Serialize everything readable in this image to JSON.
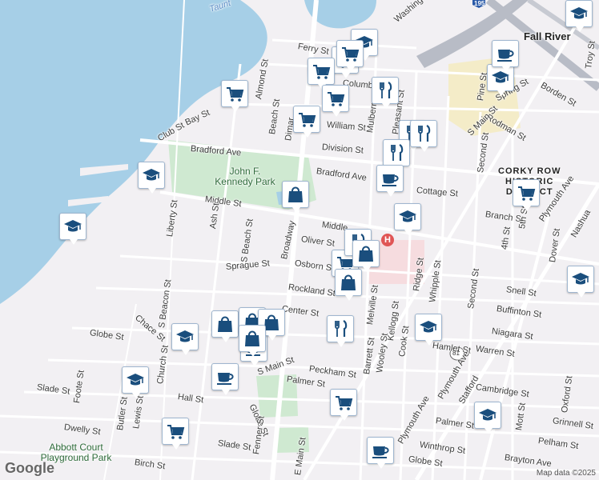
{
  "map": {
    "city": "Fall River",
    "district": [
      "CORKY ROW",
      "HISTORIC",
      "DISTRICT"
    ],
    "attribution": "Map data ©2025",
    "logo": "Google",
    "highway_shield": "195",
    "route_shield": "81",
    "hospital_letter": "H",
    "parks": [
      {
        "id": "jfk",
        "text": "John F. Kennedy Park"
      },
      {
        "id": "abbott",
        "text": "Abbott Court Playground Park"
      }
    ],
    "water_label": "Taunt",
    "streets": [
      {
        "text": "Ferry St"
      },
      {
        "text": "Columbia"
      },
      {
        "text": "Almond St"
      },
      {
        "text": "Club St"
      },
      {
        "text": "Bay St"
      },
      {
        "text": "Bradford Ave"
      },
      {
        "text": "Bradford Ave"
      },
      {
        "text": "Beach St"
      },
      {
        "text": "Dimar"
      },
      {
        "text": "William St"
      },
      {
        "text": "Division St"
      },
      {
        "text": "Cottage St"
      },
      {
        "text": "Middle St"
      },
      {
        "text": "Middle"
      },
      {
        "text": "Oliver St"
      },
      {
        "text": "Sprague St"
      },
      {
        "text": "Osborn St"
      },
      {
        "text": "Rockland St"
      },
      {
        "text": "Center St"
      },
      {
        "text": "Broadway"
      },
      {
        "text": "Liberty St"
      },
      {
        "text": "Ash St"
      },
      {
        "text": "S Beach St"
      },
      {
        "text": "S Beacon St"
      },
      {
        "text": "Chace St"
      },
      {
        "text": "Globe St"
      },
      {
        "text": "Church St"
      },
      {
        "text": "Hall St"
      },
      {
        "text": "Slade St"
      },
      {
        "text": "Foote St"
      },
      {
        "text": "Butler St"
      },
      {
        "text": "Lewis St"
      },
      {
        "text": "Dwelly St"
      },
      {
        "text": "Birch St"
      },
      {
        "text": "S Main St"
      },
      {
        "text": "Globe St"
      },
      {
        "text": "Palmer St"
      },
      {
        "text": "Peckham St"
      },
      {
        "text": "Fenner St"
      },
      {
        "text": "E Main St"
      },
      {
        "text": "Slade St"
      },
      {
        "text": "Globe St"
      },
      {
        "text": "Winthrop St"
      },
      {
        "text": "Palmer St"
      },
      {
        "text": "Plymouth Ave"
      },
      {
        "text": "Plymouth Ave"
      },
      {
        "text": "Brayton Ave"
      },
      {
        "text": "Pelham St"
      },
      {
        "text": "Grinnell St"
      },
      {
        "text": "Oxford St"
      },
      {
        "text": "Mott St"
      },
      {
        "text": "Cambridge St"
      },
      {
        "text": "Warren St"
      },
      {
        "text": "Niagara St"
      },
      {
        "text": "Buffinton St"
      },
      {
        "text": "Snell St"
      },
      {
        "text": "Hamlet St"
      },
      {
        "text": "Cook St"
      },
      {
        "text": "Wooley St"
      },
      {
        "text": "Barrett St"
      },
      {
        "text": "Kellogg St"
      },
      {
        "text": "Melville St"
      },
      {
        "text": "Ridge St"
      },
      {
        "text": "Whipple St"
      },
      {
        "text": "Second St"
      },
      {
        "text": "Branch St"
      },
      {
        "text": "Dover St"
      },
      {
        "text": "Nashua"
      },
      {
        "text": "4th St"
      },
      {
        "text": "5th St"
      },
      {
        "text": "Rodman St"
      },
      {
        "text": "Spring St"
      },
      {
        "text": "Borden St"
      },
      {
        "text": "Second St"
      },
      {
        "text": "S Main St"
      },
      {
        "text": "Plymouth Ave"
      },
      {
        "text": "Stafford"
      },
      {
        "text": "Mulberry"
      },
      {
        "text": "Pleasant St"
      },
      {
        "text": "Troy St"
      },
      {
        "text": "Washington St"
      },
      {
        "text": "Pine St"
      }
    ],
    "markers": [
      {
        "type": "education-icon"
      },
      {
        "type": "education-icon"
      },
      {
        "type": "education-icon"
      },
      {
        "type": "education-icon"
      },
      {
        "type": "education-icon"
      },
      {
        "type": "education-icon"
      },
      {
        "type": "education-icon"
      },
      {
        "type": "education-icon"
      },
      {
        "type": "education-icon"
      },
      {
        "type": "education-icon"
      },
      {
        "type": "education-icon"
      },
      {
        "type": "shopping-cart-icon"
      },
      {
        "type": "shopping-cart-icon"
      },
      {
        "type": "shopping-cart-icon"
      },
      {
        "type": "shopping-cart-icon"
      },
      {
        "type": "shopping-cart-icon"
      },
      {
        "type": "shopping-cart-icon"
      },
      {
        "type": "shopping-cart-icon"
      },
      {
        "type": "shopping-cart-icon"
      },
      {
        "type": "shopping-cart-icon"
      },
      {
        "type": "shopping-cart-icon"
      },
      {
        "type": "restaurant-icon"
      },
      {
        "type": "restaurant-icon"
      },
      {
        "type": "restaurant-icon"
      },
      {
        "type": "restaurant-icon"
      },
      {
        "type": "restaurant-icon"
      },
      {
        "type": "restaurant-icon"
      },
      {
        "type": "cafe-icon"
      },
      {
        "type": "cafe-icon"
      },
      {
        "type": "cafe-icon"
      },
      {
        "type": "cafe-icon"
      },
      {
        "type": "cafe-icon"
      },
      {
        "type": "shopping-bag-icon"
      },
      {
        "type": "shopping-bag-icon"
      },
      {
        "type": "shopping-bag-icon"
      },
      {
        "type": "shopping-bag-icon"
      },
      {
        "type": "shopping-bag-icon"
      },
      {
        "type": "shopping-bag-icon"
      },
      {
        "type": "shopping-bag-icon"
      }
    ],
    "colors": {
      "water": "#a6cfe7",
      "park": "#cfe9d1",
      "road": "#ffffff",
      "land": "#f2f0f3",
      "highway": "#b8bcc6",
      "marker": "#1a4e7d",
      "downtown": "#f4ecc8",
      "hospital_area": "#f6dcdf"
    }
  }
}
